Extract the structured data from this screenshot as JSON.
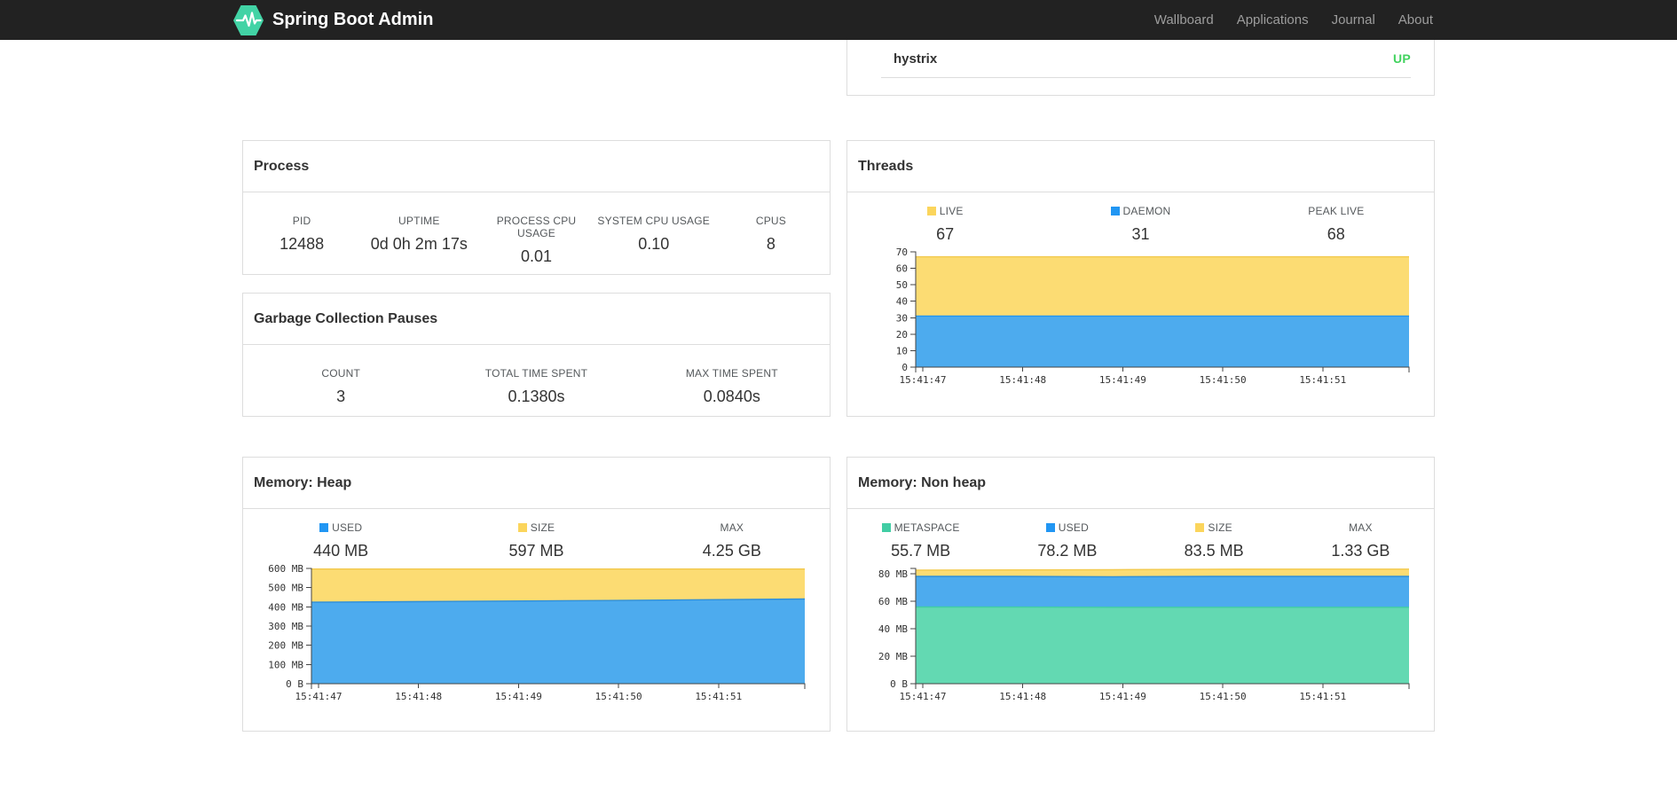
{
  "navbar": {
    "brand": "Spring Boot Admin",
    "logo_color": "#42d3a5",
    "items": [
      {
        "label": "Wallboard"
      },
      {
        "label": "Applications"
      },
      {
        "label": "Journal"
      },
      {
        "label": "About"
      }
    ]
  },
  "application_row": {
    "name": "hystrix",
    "status": "UP",
    "status_color": "#42d35f"
  },
  "cards": {
    "process": {
      "title": "Process",
      "stats": [
        {
          "label": "PID",
          "value": "12488"
        },
        {
          "label": "UPTIME",
          "value": "0d 0h 2m 17s"
        },
        {
          "label": "PROCESS CPU USAGE",
          "value": "0.01"
        },
        {
          "label": "SYSTEM CPU USAGE",
          "value": "0.10"
        },
        {
          "label": "CPUS",
          "value": "8"
        }
      ]
    },
    "gc": {
      "title": "Garbage Collection Pauses",
      "stats": [
        {
          "label": "COUNT",
          "value": "3"
        },
        {
          "label": "TOTAL TIME SPENT",
          "value": "0.1380s"
        },
        {
          "label": "MAX TIME SPENT",
          "value": "0.0840s"
        }
      ]
    },
    "threads": {
      "title": "Threads",
      "stats": [
        {
          "label": "LIVE",
          "value": "67",
          "swatch": "#fbd55c"
        },
        {
          "label": "DAEMON",
          "value": "31",
          "swatch": "#2196f3"
        },
        {
          "label": "PEAK LIVE",
          "value": "68"
        }
      ]
    },
    "heap": {
      "title": "Memory: Heap",
      "stats": [
        {
          "label": "USED",
          "value": "440 MB",
          "swatch": "#2196f3"
        },
        {
          "label": "SIZE",
          "value": "597 MB",
          "swatch": "#fbd55c"
        },
        {
          "label": "MAX",
          "value": "4.25 GB"
        }
      ]
    },
    "nonheap": {
      "title": "Memory: Non heap",
      "stats": [
        {
          "label": "METASPACE",
          "value": "55.7 MB",
          "swatch": "#41cda4"
        },
        {
          "label": "USED",
          "value": "78.2 MB",
          "swatch": "#2196f3"
        },
        {
          "label": "SIZE",
          "value": "83.5 MB",
          "swatch": "#fbd55c"
        },
        {
          "label": "MAX",
          "value": "1.33 GB"
        }
      ]
    }
  },
  "chart_data": [
    {
      "id": "threads",
      "type": "area",
      "stacked": true,
      "title": "Threads",
      "x_tick_labels": [
        "15:41:47",
        "15:41:48",
        "15:41:49",
        "15:41:50",
        "15:41:51"
      ],
      "ylim": [
        0,
        70
      ],
      "y_ticks": [
        {
          "v": 0,
          "label": "0"
        },
        {
          "v": 10,
          "label": "10"
        },
        {
          "v": 20,
          "label": "20"
        },
        {
          "v": 30,
          "label": "30"
        },
        {
          "v": 40,
          "label": "40"
        },
        {
          "v": 50,
          "label": "50"
        },
        {
          "v": 60,
          "label": "60"
        },
        {
          "v": 70,
          "label": "70"
        }
      ],
      "values_are": "stacked_totals",
      "series": [
        {
          "name": "DAEMON",
          "line": "#2196f3",
          "fill": "#4dabee",
          "values": [
            31,
            31,
            31,
            31,
            31,
            31
          ]
        },
        {
          "name": "LIVE",
          "line": "#f2c94c",
          "fill": "#fcdc73",
          "values": [
            67,
            67,
            67,
            67,
            67,
            67
          ]
        }
      ],
      "grid": false,
      "legend_position": "top"
    },
    {
      "id": "heap",
      "type": "area",
      "stacked": true,
      "title": "Memory: Heap",
      "x_tick_labels": [
        "15:41:47",
        "15:41:48",
        "15:41:49",
        "15:41:50",
        "15:41:51"
      ],
      "ylim": [
        0,
        600
      ],
      "y_ticks": [
        {
          "v": 0,
          "label": "0 B"
        },
        {
          "v": 100,
          "label": "100 MB"
        },
        {
          "v": 200,
          "label": "200 MB"
        },
        {
          "v": 300,
          "label": "300 MB"
        },
        {
          "v": 400,
          "label": "400 MB"
        },
        {
          "v": 500,
          "label": "500 MB"
        },
        {
          "v": 600,
          "label": "600 MB"
        }
      ],
      "values_are": "stacked_totals",
      "series": [
        {
          "name": "USED",
          "line": "#2f8fd8",
          "fill": "#4dabee",
          "values": [
            424,
            427,
            430,
            433,
            437,
            441
          ]
        },
        {
          "name": "SIZE",
          "line": "#f2c94c",
          "fill": "#fcdc73",
          "values": [
            597,
            597,
            597,
            597,
            597,
            597
          ]
        }
      ],
      "grid": false,
      "legend_position": "top"
    },
    {
      "id": "nonheap",
      "type": "area",
      "stacked": true,
      "title": "Memory: Non heap",
      "x_tick_labels": [
        "15:41:47",
        "15:41:48",
        "15:41:49",
        "15:41:50",
        "15:41:51"
      ],
      "ylim": [
        0,
        84
      ],
      "y_ticks": [
        {
          "v": 0,
          "label": "0 B"
        },
        {
          "v": 20,
          "label": "20 MB"
        },
        {
          "v": 40,
          "label": "40 MB"
        },
        {
          "v": 60,
          "label": "60 MB"
        },
        {
          "v": 80,
          "label": "80 MB"
        }
      ],
      "values_are": "stacked_totals",
      "series": [
        {
          "name": "METASPACE",
          "line": "#41cda4",
          "fill": "#63d9b2",
          "values": [
            55.9,
            55.8,
            55.7,
            55.7,
            55.7,
            55.7
          ]
        },
        {
          "name": "USED",
          "line": "#2f8fd8",
          "fill": "#4dabee",
          "values": [
            78.2,
            78.2,
            77.9,
            78.2,
            78.2,
            78.2
          ]
        },
        {
          "name": "SIZE",
          "line": "#f2c94c",
          "fill": "#fcdc73",
          "values": [
            82.8,
            82.9,
            83.1,
            83.4,
            83.5,
            83.5
          ]
        }
      ],
      "grid": false,
      "legend_position": "top"
    }
  ]
}
